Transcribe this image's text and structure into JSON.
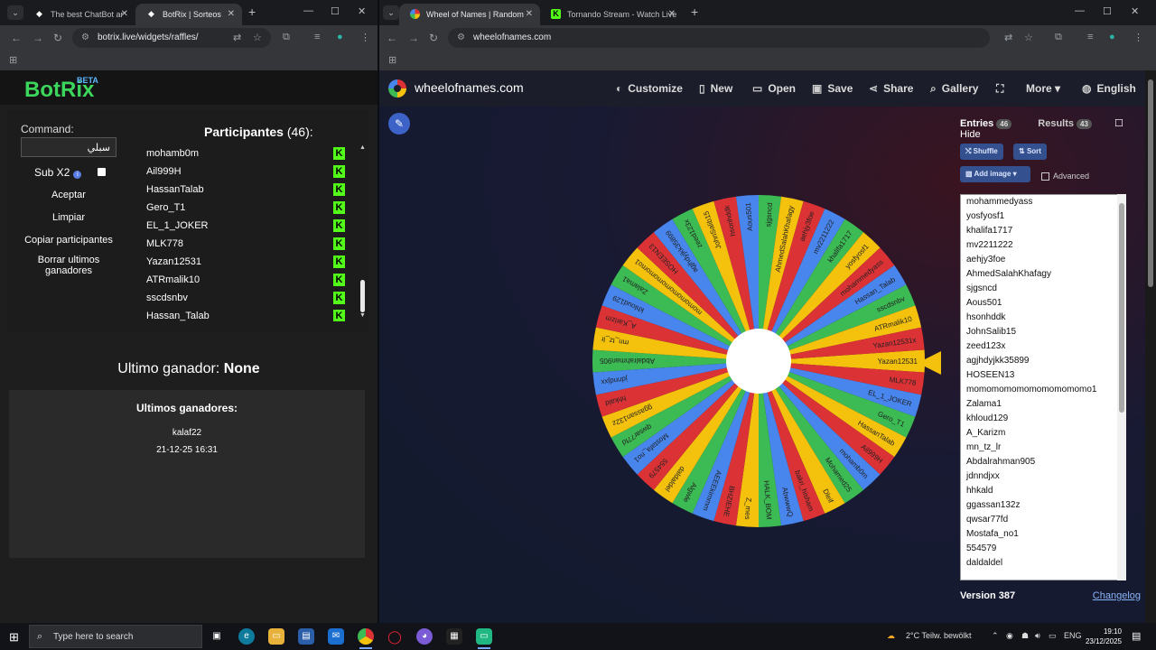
{
  "left_browser": {
    "tabs": [
      {
        "title": "The best ChatBot ar",
        "favicon": "chatbot-icon"
      },
      {
        "title": "BotRix | Sorteos",
        "favicon": "botrix-icon"
      }
    ],
    "url": "botrix.live/widgets/raffles/"
  },
  "right_browser": {
    "tabs": [
      {
        "title": "Wheel of Names | Random",
        "favicon": "wheel-icon"
      },
      {
        "title": "Tornando Stream - Watch Live",
        "favicon": "kick-icon"
      }
    ],
    "url": "wheelofnames.com"
  },
  "botrix": {
    "logo": "BotRix",
    "beta": "BETA",
    "command_label": "Command:",
    "command_value": "سبلي",
    "sub_label": "Sub X2",
    "sub_info": "i",
    "buttons": {
      "accept": "Aceptar",
      "clear": "Limpiar",
      "copy": "Copiar participantes",
      "delete_winners": "Borrar ultimos ganadores"
    },
    "participants_label": "Participantes",
    "participants_count": "(46):",
    "participants": [
      "mohamb0m",
      "Ail999H",
      "HassanTalab",
      "Gero_T1",
      "EL_1_JOKER",
      "MLK778",
      "Yazan12531",
      "ATRmalik10",
      "sscdsnbv",
      "Hassan_Talab"
    ],
    "platform_badge": "K",
    "last_winner_label": "Ultimo ganador:",
    "last_winner_value": "None",
    "winners_title": "Ultimos ganadores:",
    "winners": [
      {
        "name": "kalaf22",
        "date": "21-12-25 16:31"
      }
    ]
  },
  "wheelofnames": {
    "site": "wheelofnames.com",
    "menu": {
      "customize": "Customize",
      "new": "New",
      "open": "Open",
      "save": "Save",
      "share": "Share",
      "gallery": "Gallery",
      "more": "More",
      "language": "English"
    },
    "tabs": {
      "entries_label": "Entries",
      "entries_count": "46",
      "results_label": "Results",
      "results_count": "43",
      "hide_label": "Hide"
    },
    "buttons": {
      "shuffle": "Shuffle",
      "sort": "Sort",
      "add_image": "Add image",
      "advanced": "Advanced"
    },
    "entries": [
      "mohammedyass",
      "yosfyosf1",
      "khalifa1717",
      "mv2211222",
      "aehjy3foe",
      "AhmedSalahKhafagy",
      "sjgsncd",
      "Aous501",
      "hsonhddk",
      "JohnSalib15",
      "zeed123x",
      "agjhdyjkk35899",
      "HOSEEN13",
      "momomomomomomomomomo1",
      "Zalama1",
      "khloud129",
      "A_Karizm",
      "mn_tz_lr",
      "Abdalrahman905",
      "jdnndjxx",
      "hhkald",
      "ggassan132z",
      "qwsar77fd",
      "Mostafa_no1",
      "554579",
      "daldaldel"
    ],
    "wheel_segments": [
      "Yazan12531",
      "MLK778",
      "EL_1_JOKER",
      "Gero_T1",
      "HassanTalab",
      "Ail999H",
      "mohamb0m",
      "Mohamed25",
      "Dleif",
      "bakri_hisham",
      "AbwwwQ",
      "HALK_BOM",
      "Z_mes",
      "BHZIEHE",
      "AEEEkimmm",
      "Algwle",
      "daldaldel",
      "554579",
      "Mostafa_no1",
      "qwsar77fd",
      "ggassan132z",
      "hhkald",
      "jdnndjxx",
      "Abdalrahman905",
      "mn_tz_lr",
      "A_Karizm",
      "khloud129",
      "Zalama1",
      "momomomomomomomo1",
      "HOSEEN13",
      "agjhdyjkk35899",
      "zeed123x",
      "JohnSalib15",
      "hsonhddk",
      "Aous501",
      "sjgsncd",
      "AhmedSalahKhafagy",
      "aehjy3foe",
      "mv2211222",
      "khalifa1717",
      "yosfyosf1",
      "mohammedyass",
      "Hassan_Talab",
      "sscdsnbv",
      "ATRmalik10",
      "Yazan12531x"
    ],
    "wheel_colors": [
      "#f4c20d",
      "#db3236",
      "#4885ed",
      "#3cba54"
    ],
    "version": "Version 387",
    "changelog": "Changelog"
  },
  "taskbar": {
    "search_placeholder": "Type here to search",
    "weather": "2°C  Teilw. bewölkt",
    "language": "ENG",
    "time": "19:10",
    "date": "23/12/2025"
  }
}
